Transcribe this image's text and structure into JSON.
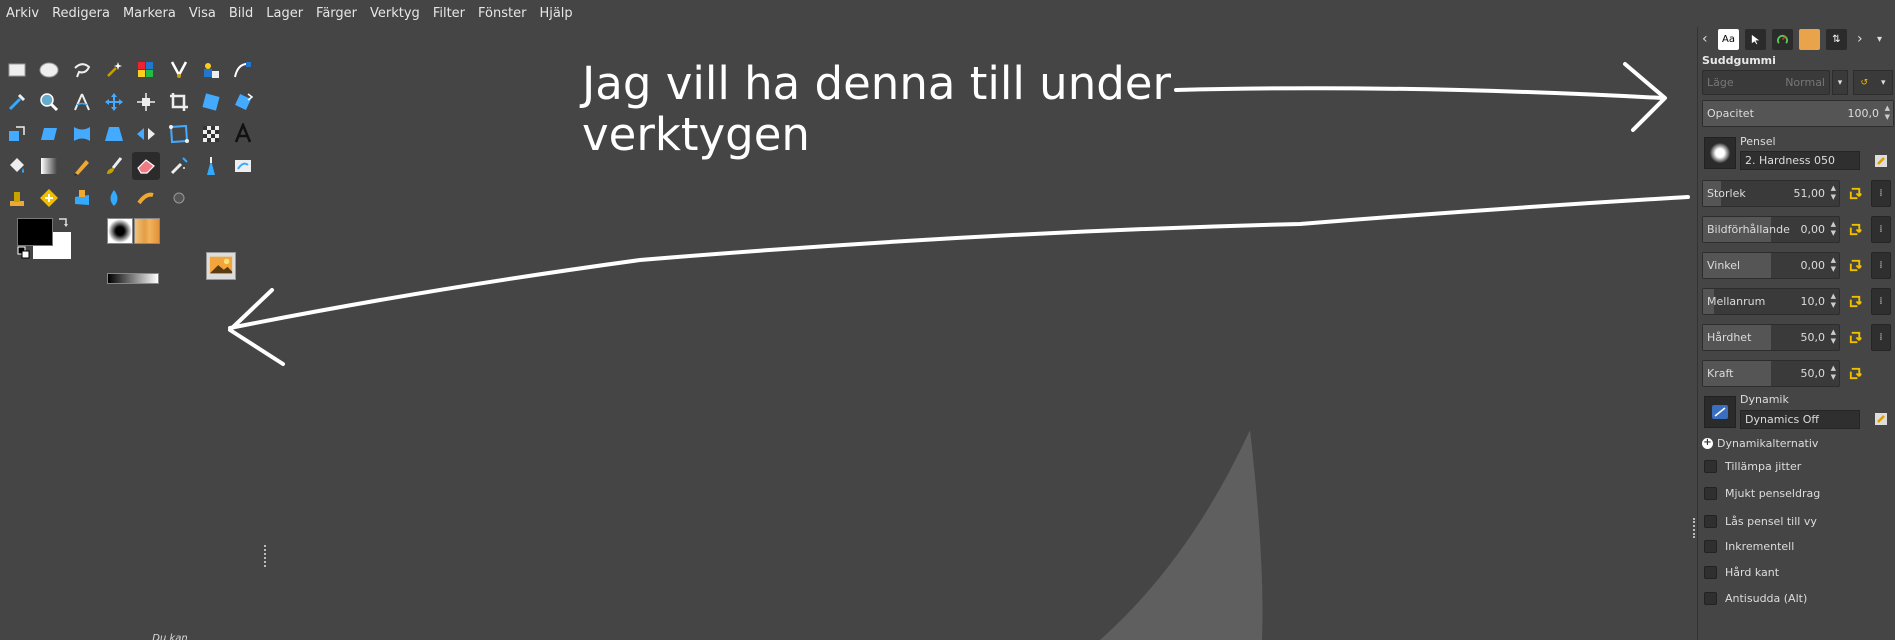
{
  "menu": [
    "Arkiv",
    "Redigera",
    "Markera",
    "Visa",
    "Bild",
    "Lager",
    "Färger",
    "Verktyg",
    "Filter",
    "Fönster",
    "Hjälp"
  ],
  "toolbox": {
    "tools": [
      {
        "name": "rect-select-icon"
      },
      {
        "name": "ellipse-select-icon"
      },
      {
        "name": "lasso-select-icon"
      },
      {
        "name": "fuzzy-select-icon"
      },
      {
        "name": "color-select-icon"
      },
      {
        "name": "scissors-select-icon"
      },
      {
        "name": "foreground-select-icon"
      },
      {
        "name": "paths-icon"
      },
      {
        "name": "color-picker-icon"
      },
      {
        "name": "zoom-icon"
      },
      {
        "name": "measure-icon"
      },
      {
        "name": "move-icon"
      },
      {
        "name": "align-icon"
      },
      {
        "name": "crop-icon"
      },
      {
        "name": "unified-transform-icon"
      },
      {
        "name": "rotate-icon"
      },
      {
        "name": "scale-icon"
      },
      {
        "name": "shear-icon"
      },
      {
        "name": "warp-icon"
      },
      {
        "name": "perspective-icon"
      },
      {
        "name": "flip-icon"
      },
      {
        "name": "cage-icon"
      },
      {
        "name": "checker-icon"
      },
      {
        "name": "text-icon"
      },
      {
        "name": "bucket-fill-icon"
      },
      {
        "name": "gradient-icon"
      },
      {
        "name": "pencil-icon"
      },
      {
        "name": "paintbrush-icon"
      },
      {
        "name": "eraser-icon"
      },
      {
        "name": "airbrush-icon"
      },
      {
        "name": "ink-icon"
      },
      {
        "name": "mypaint-brush-icon"
      },
      {
        "name": "clone-icon"
      },
      {
        "name": "heal-icon"
      },
      {
        "name": "perspective-clone-icon"
      },
      {
        "name": "blur-icon"
      },
      {
        "name": "smudge-icon"
      },
      {
        "name": "dodge-burn-icon"
      }
    ],
    "active_tool": "eraser-icon",
    "dnd_hint": "Du kan släppa"
  },
  "annotation": "Jag vill ha denna till under verktygen",
  "dock": {
    "title": "Suddgummi",
    "mode_label": "Läge",
    "mode_value": "Normal",
    "opacity": {
      "label": "Opacitet",
      "value": "100,0",
      "fraction": 1.0
    },
    "brush_label": "Pensel",
    "brush_name": "2. Hardness 050",
    "params": [
      {
        "label": "Storlek",
        "value": "51,00",
        "fraction": 0.13
      },
      {
        "label": "Bildförhållande",
        "value": "0,00",
        "fraction": 0.5
      },
      {
        "label": "Vinkel",
        "value": "0,00",
        "fraction": 0.5
      },
      {
        "label": "Mellanrum",
        "value": "10,0",
        "fraction": 0.08
      },
      {
        "label": "Hårdhet",
        "value": "50,0",
        "fraction": 0.5
      },
      {
        "label": "Kraft",
        "value": "50,0",
        "fraction": 0.5
      }
    ],
    "dynamics_label": "Dynamik",
    "dynamics_name": "Dynamics Off",
    "dynamics_options": "Dynamikalternativ",
    "checks": [
      "Tillämpa jitter",
      "Mjukt penseldrag",
      "Lås pensel till vy",
      "Inkrementell",
      "Hård kant",
      "Antisudda  (Alt)"
    ]
  }
}
